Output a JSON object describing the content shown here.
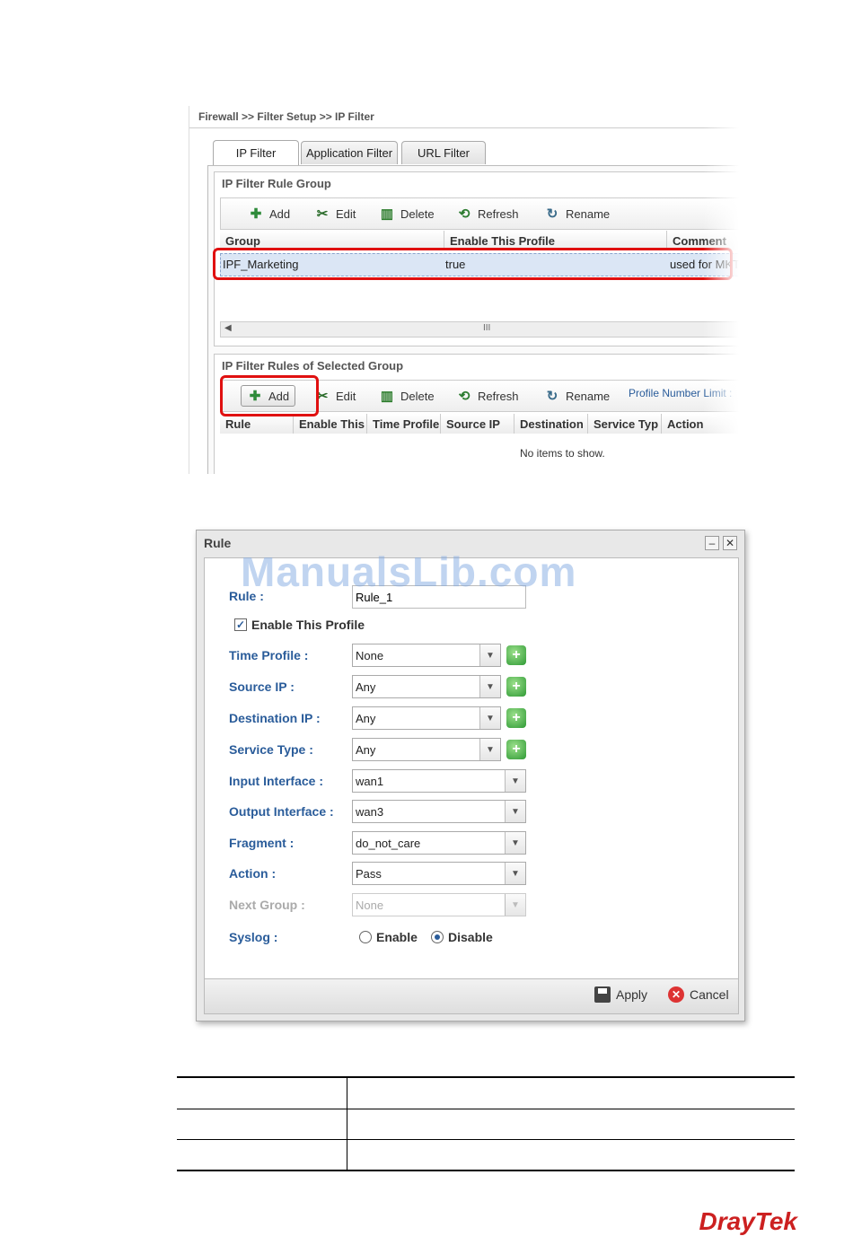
{
  "page1": {
    "breadcrumb": "Firewall >> Filter Setup >> IP Filter",
    "tabs": [
      {
        "label": "IP Filter",
        "active": true
      },
      {
        "label": "Application Filter",
        "active": false
      },
      {
        "label": "URL Filter",
        "active": false
      }
    ],
    "rule_group": {
      "title": "IP Filter Rule Group",
      "toolbar": {
        "add": "Add",
        "edit": "Edit",
        "delete": "Delete",
        "refresh": "Refresh",
        "rename": "Rename"
      },
      "columns": [
        "Group",
        "Enable This Profile",
        "Comment"
      ],
      "rows": [
        {
          "group": "IPF_Marketing",
          "enable": "true",
          "comment": "used for MKT"
        }
      ],
      "scroll_grip": "III"
    },
    "rules": {
      "title": "IP Filter Rules of Selected Group",
      "toolbar": {
        "add": "Add",
        "edit": "Edit",
        "delete": "Delete",
        "refresh": "Refresh",
        "rename": "Rename",
        "limit": "Profile Number Limit :"
      },
      "columns": [
        "Rule",
        "Enable This",
        "Time Profile",
        "Source IP",
        "Destination",
        "Service Typ",
        "Action"
      ],
      "empty": "No items to show."
    }
  },
  "dialog": {
    "title": "Rule",
    "rule_label": "Rule :",
    "rule_value": "Rule_1",
    "enable_label": "Enable This Profile",
    "enable_checked": true,
    "fields": [
      {
        "label": "Time Profile :",
        "value": "None",
        "has_add": true
      },
      {
        "label": "Source IP :",
        "value": "Any",
        "has_add": true
      },
      {
        "label": "Destination IP :",
        "value": "Any",
        "has_add": true
      },
      {
        "label": "Service Type :",
        "value": "Any",
        "has_add": true
      },
      {
        "label": "Input Interface :",
        "value": "wan1",
        "has_add": false
      },
      {
        "label": "Output Interface :",
        "value": "wan3",
        "has_add": false
      },
      {
        "label": "Fragment :",
        "value": "do_not_care",
        "has_add": false
      },
      {
        "label": "Action :",
        "value": "Pass",
        "has_add": false
      },
      {
        "label": "Next Group :",
        "value": "None",
        "has_add": false,
        "disabled": true
      }
    ],
    "syslog": {
      "label": "Syslog :",
      "enable": "Enable",
      "disable": "Disable",
      "selected": "Disable"
    },
    "apply": "Apply",
    "cancel": "Cancel"
  },
  "watermark": "ManualsLib.com",
  "logo": "DrayTek",
  "colors": {
    "highlight": "#e01010",
    "label": "#2a5c9a",
    "brand": "#cc2020"
  }
}
